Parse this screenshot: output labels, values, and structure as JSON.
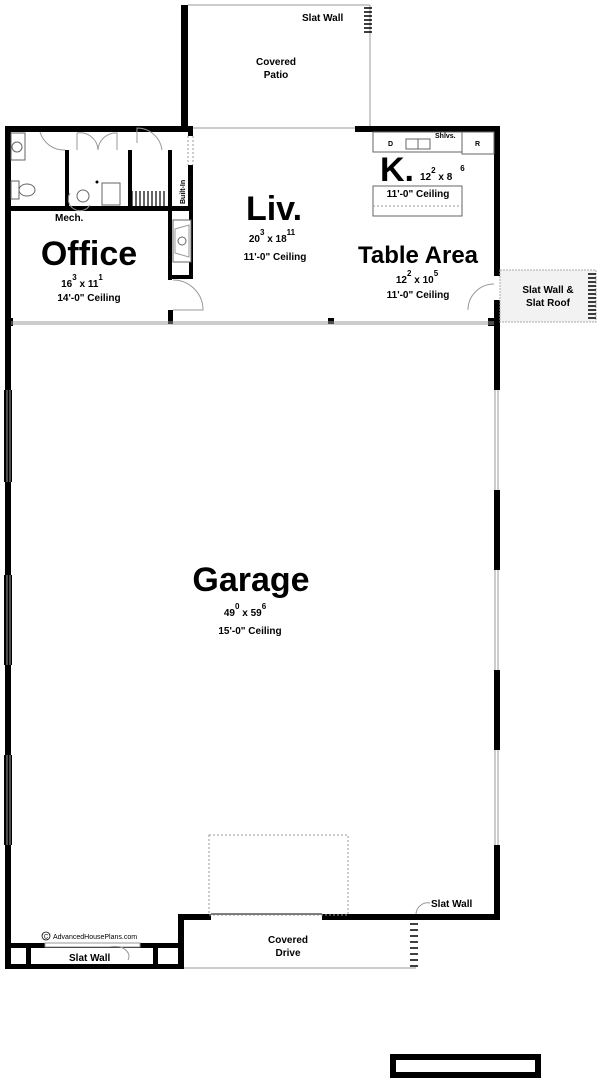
{
  "rooms": {
    "office": {
      "name": "Office",
      "w": "16",
      "w_in": "3",
      "h": "11",
      "h_in": "1",
      "ceiling": "14'-0\" Ceiling"
    },
    "living": {
      "name": "Liv.",
      "w": "20",
      "w_in": "3",
      "h": "18",
      "h_in": "11",
      "ceiling": "11'-0\" Ceiling"
    },
    "kitchen": {
      "name": "K.",
      "w": "12",
      "w_in": "2",
      "h": "8",
      "h_in": "6",
      "ceiling": "11'-0\" Ceiling"
    },
    "table_area": {
      "name": "Table Area",
      "w": "12",
      "w_in": "2",
      "h": "10",
      "h_in": "5",
      "ceiling": "11'-0\" Ceiling"
    },
    "garage": {
      "name": "Garage",
      "w": "49",
      "w_in": "0",
      "h": "59",
      "h_in": "6",
      "ceiling": "15'-0\" Ceiling"
    }
  },
  "labels": {
    "covered_patio": [
      "Covered",
      "Patio"
    ],
    "covered_drive": [
      "Covered",
      "Drive"
    ],
    "slat_wall_top": "Slat Wall",
    "slat_wall_roof": [
      "Slat Wall &",
      "Slat Roof"
    ],
    "slat_wall_right": "Slat Wall",
    "slat_wall_bottom": "Slat Wall",
    "mech": "Mech.",
    "built_in": "Built-In",
    "shelves": "Shlvs.",
    "dishwasher": "D",
    "refrigerator": "R"
  },
  "watermark": "AdvancedHousePlans.com",
  "copyright_symbol": "C"
}
